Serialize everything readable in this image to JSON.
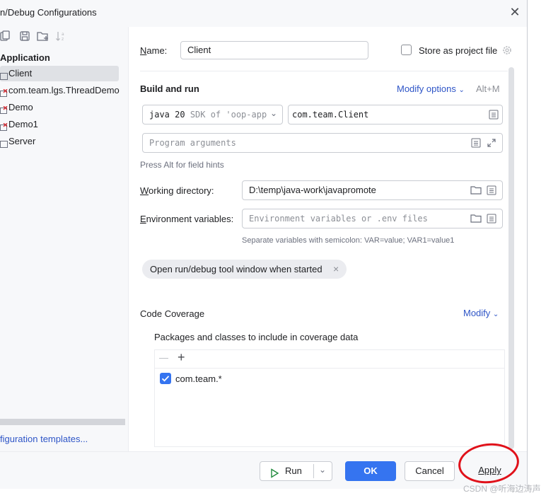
{
  "window": {
    "title": "n/Debug Configurations",
    "close_glyph": "✕"
  },
  "left": {
    "section_title": "Application",
    "items": [
      {
        "label": "Client",
        "error": false,
        "selected": true
      },
      {
        "label": "com.team.lgs.ThreadDemo",
        "error": true,
        "selected": false
      },
      {
        "label": "Demo",
        "error": true,
        "selected": false
      },
      {
        "label": "Demo1",
        "error": true,
        "selected": false
      },
      {
        "label": "Server",
        "error": false,
        "selected": false
      }
    ],
    "templates_link": "figuration templates..."
  },
  "form": {
    "name_label": "Name:",
    "name_value": "Client",
    "store_label": "Store as project file",
    "store_checked": false,
    "build_run_title": "Build and run",
    "modify_options": "Modify options",
    "modify_shortcut": "Alt+M",
    "jdk_version": "java 20",
    "jdk_detail": "SDK of 'oop-app",
    "main_class": "com.team.Client",
    "program_args_placeholder": "Program arguments",
    "alt_hint": "Press Alt for field hints",
    "working_dir_label": "Working directory:",
    "working_dir_value": "D:\\temp\\java-work\\javapromote",
    "env_label": "Environment variables:",
    "env_placeholder": "Environment variables or .env files",
    "env_hint": "Separate variables with semicolon: VAR=value; VAR1=value1",
    "tool_window_chip": "Open run/debug tool window when started",
    "chip_close": "×",
    "coverage_title": "Code Coverage",
    "coverage_modify": "Modify",
    "packages_label": "Packages and classes to include in coverage data",
    "minus_glyph": "—",
    "plus_glyph": "+",
    "coverage_entries": [
      {
        "label": "com.team.*",
        "checked": true
      }
    ]
  },
  "buttons": {
    "run": "Run",
    "ok": "OK",
    "cancel": "Cancel",
    "apply": "Apply"
  },
  "colors": {
    "accent": "#3574f0",
    "link": "#2e55c7",
    "annotation_circle": "#e0111a",
    "error_mark": "#d9272e"
  },
  "watermark": "CSDN @听海边涛声"
}
